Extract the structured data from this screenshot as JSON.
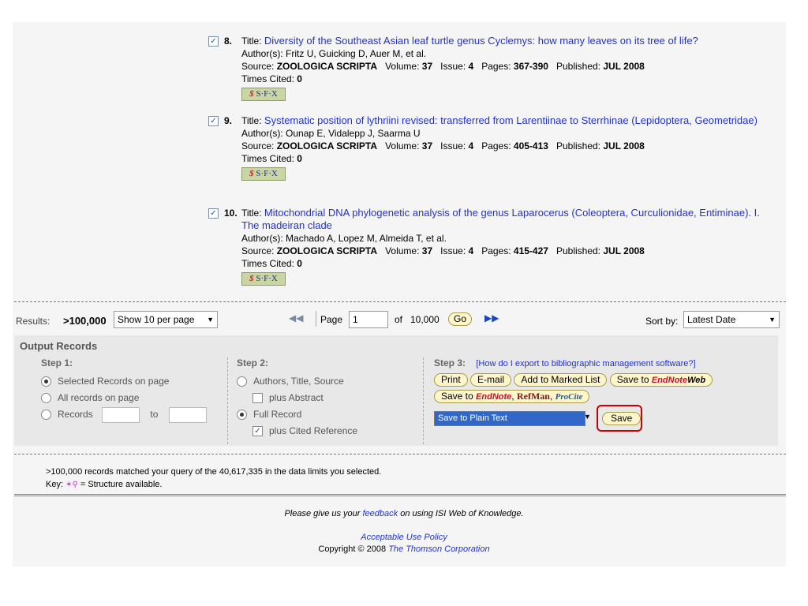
{
  "records": [
    {
      "number": "8.",
      "title_label": "Title:",
      "title": "Diversity of the Southeast Asian leaf turtle genus Cyclemys: how many leaves on its tree of life?",
      "authors_label": "Author(s):",
      "authors": "Fritz U, Guicking D, Auer M, et al.",
      "source_label": "Source:",
      "source": "ZOOLOGICA SCRIPTA",
      "volume_label": "Volume:",
      "volume": "37",
      "issue_label": "Issue:",
      "issue": "4",
      "pages_label": "Pages:",
      "pages": "367-390",
      "published_label": "Published:",
      "published": "JUL 2008",
      "cited_label": "Times Cited:",
      "cited": "0",
      "sfx": "S·F·X"
    },
    {
      "number": "9.",
      "title_label": "Title:",
      "title": "Systematic position of lythriini revised: transferred from Larentiinae to Sterrhinae (Lepidoptera, Geometridae)",
      "authors_label": "Author(s):",
      "authors": "Ounap E, Vidalepp J, Saarma U",
      "source_label": "Source:",
      "source": "ZOOLOGICA SCRIPTA",
      "volume_label": "Volume:",
      "volume": "37",
      "issue_label": "Issue:",
      "issue": "4",
      "pages_label": "Pages:",
      "pages": "405-413",
      "published_label": "Published:",
      "published": "JUL 2008",
      "cited_label": "Times Cited:",
      "cited": "0",
      "sfx": "S·F·X"
    },
    {
      "number": "10.",
      "title_label": "Title:",
      "title": "Mitochondrial DNA phylogenetic analysis of the genus Laparocerus (Coleoptera, Curculionidae, Entiminae). I. The madeiran clade",
      "authors_label": "Author(s):",
      "authors": "Machado A, Lopez M, Almeida T, et al.",
      "source_label": "Source:",
      "source": "ZOOLOGICA SCRIPTA",
      "volume_label": "Volume:",
      "volume": "37",
      "issue_label": "Issue:",
      "issue": "4",
      "pages_label": "Pages:",
      "pages": "415-427",
      "published_label": "Published:",
      "published": "JUL 2008",
      "cited_label": "Times Cited:",
      "cited": "0",
      "sfx": "S·F·X"
    }
  ],
  "results_bar": {
    "results_label": "Results:",
    "results_count": ">100,000",
    "per_page": "Show 10 per page",
    "page_label": "Page",
    "page_value": "1",
    "of_label": "of",
    "total_pages": "10,000",
    "go_label": "Go",
    "sort_label": "Sort by:",
    "sort_value": "Latest Date"
  },
  "output": {
    "heading": "Output Records",
    "step1": {
      "heading": "Step 1:",
      "selected": "Selected Records on page",
      "all": "All records on page",
      "records": "Records",
      "to": "to"
    },
    "step2": {
      "heading": "Step 2:",
      "authors_title_source": "Authors, Title, Source",
      "plus_abstract": "plus Abstract",
      "full_record": "Full Record",
      "plus_cited": "plus Cited Reference"
    },
    "step3": {
      "heading": "Step 3:",
      "help_link": "[How do I export to bibliographic management software?]",
      "print": "Print",
      "email": "E-mail",
      "add_marked": "Add to Marked List",
      "save_to": "Save to",
      "endnote": "EndNote",
      "web": "Web",
      "refman": "RefMan",
      "procite": "ProCite",
      "export_format": "Save to Plain Text",
      "save": "Save"
    }
  },
  "footer": {
    "matched": ">100,000 records matched your query of the 40,617,335 in the data limits you selected.",
    "key_label": "Key:",
    "key_text": "= Structure available.",
    "feedback_pre": "Please give us your",
    "feedback_link": "feedback",
    "feedback_post": "on using ISI Web of Knowledge.",
    "policy": "Acceptable Use Policy",
    "copyright": "Copyright © 2008",
    "company": "The Thomson Corporation"
  },
  "colors": {
    "link": "#2233cc",
    "highlight": "#cc0000",
    "export_select": "#3168c8"
  }
}
